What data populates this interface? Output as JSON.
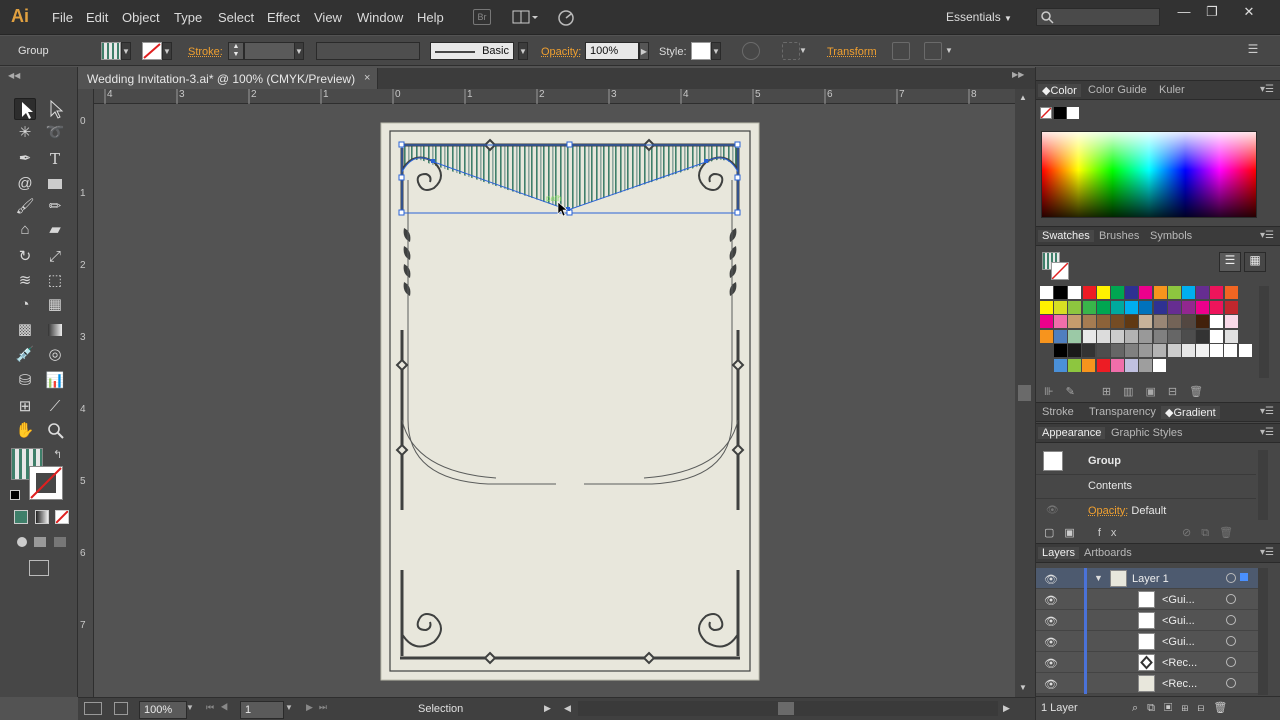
{
  "app": {
    "logo": "Ai",
    "menus": [
      "File",
      "Edit",
      "Object",
      "Type",
      "Select",
      "Effect",
      "View",
      "Window",
      "Help"
    ],
    "bridge_label": "Br",
    "workspace": "Essentials"
  },
  "control_bar": {
    "selection_type": "Group",
    "stroke_label": "Stroke:",
    "brush_label": "Basic",
    "opacity_label": "Opacity:",
    "opacity_value": "100%",
    "style_label": "Style:",
    "transform_label": "Transform"
  },
  "document": {
    "title": "Wedding Invitation-3.ai* @ 100% (CMYK/Preview)",
    "close": "×",
    "ruler_h": [
      "4",
      "3",
      "2",
      "1",
      "0",
      "1",
      "2",
      "3",
      "4",
      "5",
      "6",
      "7",
      "8"
    ],
    "ruler_v": [
      "0",
      "1",
      "2",
      "3",
      "4",
      "5",
      "6",
      "7"
    ],
    "cursor_hint": "path"
  },
  "status_bar": {
    "zoom": "100%",
    "artboard": "1",
    "tool_status": "Selection"
  },
  "color_panel": {
    "tabs": [
      "Color",
      "Color Guide",
      "Kuler"
    ]
  },
  "swatches_panel": {
    "tabs": [
      "Swatches",
      "Brushes",
      "Symbols"
    ],
    "rows": [
      [
        "#ffffff",
        "#000000",
        "#ffffff",
        "#ed1c24",
        "#fff200",
        "#00a651",
        "#2e3192",
        "#ec008c",
        "#f7941d",
        "#8dc63f",
        "#00aeef",
        "#662d91",
        "#ed145b",
        "#f26522"
      ],
      [
        "#fff200",
        "#d7df23",
        "#8dc63f",
        "#39b54a",
        "#00a651",
        "#00a99d",
        "#00aeef",
        "#0072bc",
        "#2e3192",
        "#662d91",
        "#92278f",
        "#ec008c",
        "#ed145b",
        "#c1272d"
      ],
      [
        "#ec008c",
        "#f06eaa",
        "#c69c6d",
        "#a67c52",
        "#8c6239",
        "#754c24",
        "#603913",
        "#c7b299",
        "#998675",
        "#736357",
        "#534741",
        "#42210b",
        "#ffffff",
        "#f9d9e8"
      ],
      [
        "#f7941d",
        "#4f7fbf",
        "#9bc9a6",
        "#e8e8e8",
        "#dcdcdc",
        "#cccccc",
        "#b3b3b3",
        "#999999",
        "#808080",
        "#666666",
        "#4d4d4d",
        "#333333",
        "#ffffff",
        "#e0e0e0"
      ],
      [
        "#000000",
        "#1a1a1a",
        "#333333",
        "#4d4d4d",
        "#666666",
        "#808080",
        "#999999",
        "#b3b3b3",
        "#cccccc",
        "#e6e6e6",
        "#f2f2f2",
        "#ffffff",
        "#ffffff",
        "#ffffff"
      ],
      [
        "#4a90d9",
        "#8dc63f",
        "#f7941d",
        "#ed1c24",
        "#f06eaa",
        "#c0c0e0",
        "#9e9e9e",
        "#ffffff"
      ]
    ]
  },
  "gradient_tabs": {
    "tabs": [
      "Stroke",
      "Transparency",
      "Gradient"
    ]
  },
  "appearance_panel": {
    "tabs": [
      "Appearance",
      "Graphic Styles"
    ],
    "group_label": "Group",
    "contents_label": "Contents",
    "opacity_label": "Opacity:",
    "opacity_value": "Default"
  },
  "layers_panel": {
    "tabs": [
      "Layers",
      "Artboards"
    ],
    "layer_name": "Layer 1",
    "rows": [
      "<Gui...",
      "<Gui...",
      "<Gui...",
      "<Rec...",
      "<Rec..."
    ],
    "footer": "1 Layer"
  },
  "colors": {
    "accent": "#f0a030",
    "artboard": "#e8e7dc",
    "frame": "#3f4140",
    "stripe_green": "#3f7f6a",
    "selection_blue": "#2a63d6"
  }
}
